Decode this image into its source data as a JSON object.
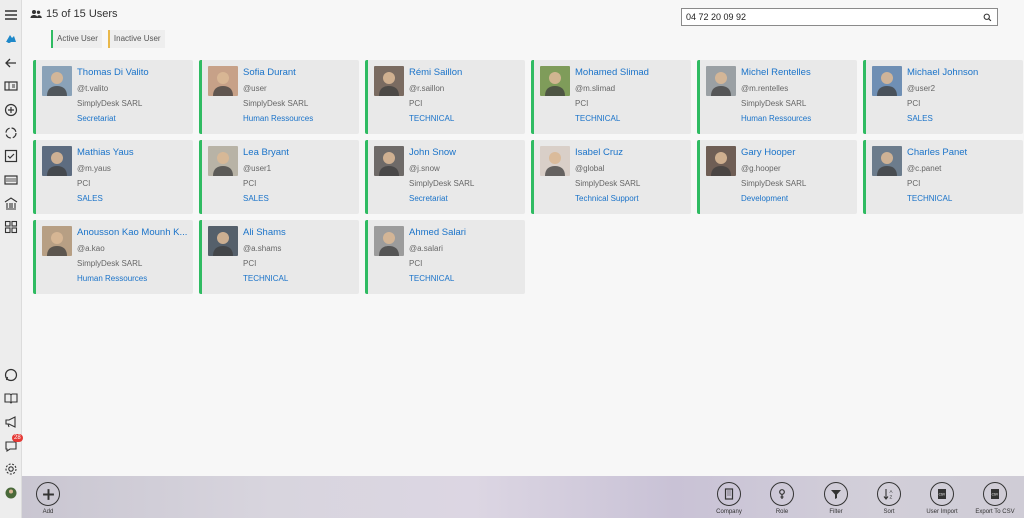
{
  "header": {
    "user_count_text": "15 of 15 Users"
  },
  "search": {
    "value": "04 72 20 09 92",
    "placeholder": ""
  },
  "legend": {
    "active": "Active User",
    "inactive": "Inactive User"
  },
  "colors": {
    "active_border": "#2fbb62",
    "inactive_border": "#e9b84a",
    "link": "#1a73c9"
  },
  "users": [
    {
      "name": "Thomas Di Valito",
      "login": "@t.valito",
      "company": "SimplyDesk SARL",
      "department": "Secretariat",
      "avatar_color": "#8aa2b8"
    },
    {
      "name": "Sofia Durant",
      "login": "@user",
      "company": "SimplyDesk SARL",
      "department": "Human Ressources",
      "avatar_color": "#c7a188"
    },
    {
      "name": "Rémi Saillon",
      "login": "@r.saillon",
      "company": "PCI",
      "department": "TECHNICAL",
      "avatar_color": "#7a6b61"
    },
    {
      "name": "Mohamed Slimad",
      "login": "@m.slimad",
      "company": "PCI",
      "department": "TECHNICAL",
      "avatar_color": "#7f9c5a"
    },
    {
      "name": "Michel Rentelles",
      "login": "@m.rentelles",
      "company": "SimplyDesk SARL",
      "department": "Human Ressources",
      "avatar_color": "#9aa0a4"
    },
    {
      "name": "Michael Johnson",
      "login": "@user2",
      "company": "PCI",
      "department": "SALES",
      "avatar_color": "#6f8fb4"
    },
    {
      "name": "Mathias Yaus",
      "login": "@m.yaus",
      "company": "PCI",
      "department": "SALES",
      "avatar_color": "#5d6c80"
    },
    {
      "name": "Lea Bryant",
      "login": "@user1",
      "company": "PCI",
      "department": "SALES",
      "avatar_color": "#b8b3a6"
    },
    {
      "name": "John Snow",
      "login": "@j.snow",
      "company": "SimplyDesk SARL",
      "department": "Secretariat",
      "avatar_color": "#6e6a68"
    },
    {
      "name": "Isabel Cruz",
      "login": "@global",
      "company": "SimplyDesk SARL",
      "department": "Technical Support",
      "avatar_color": "#d9cfc8"
    },
    {
      "name": "Gary Hooper",
      "login": "@g.hooper",
      "company": "SimplyDesk SARL",
      "department": "Development",
      "avatar_color": "#6f5e55"
    },
    {
      "name": "Charles Panet",
      "login": "@c.panet",
      "company": "PCI",
      "department": "TECHNICAL",
      "avatar_color": "#6c7c8c"
    },
    {
      "name": "Anousson Kao Mounh K...",
      "login": "@a.kao",
      "company": "SimplyDesk SARL",
      "department": "Human Ressources",
      "avatar_color": "#b79f84"
    },
    {
      "name": "Ali Shams",
      "login": "@a.shams",
      "company": "PCI",
      "department": "TECHNICAL",
      "avatar_color": "#55606b"
    },
    {
      "name": "Ahmed Salari",
      "login": "@a.salari",
      "company": "PCI",
      "department": "TECHNICAL",
      "avatar_color": "#9c9c9c"
    }
  ],
  "sidebar": {
    "icons": [
      "menu-icon",
      "logo-icon",
      "back-icon",
      "tickets-icon",
      "add-circle-icon",
      "sync-icon",
      "tasks-icon",
      "assets-icon",
      "building-icon",
      "dashboard-icon",
      "whatsapp-icon",
      "knowledge-book-icon",
      "announcement-icon",
      "chat-icon",
      "settings-icon",
      "user-avatar-icon"
    ],
    "chat_badge": "28"
  },
  "toolbar": {
    "add": "Add",
    "company": "Company",
    "role": "Role",
    "filter": "Filter",
    "sort": "Sort",
    "user_import": "User Import",
    "export_csv": "Export To CSV"
  }
}
